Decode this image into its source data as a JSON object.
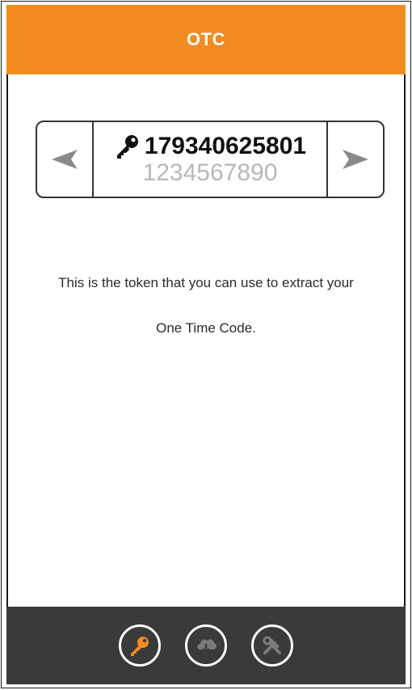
{
  "header": {
    "title": "OTC"
  },
  "token_selector": {
    "current_token": "179340625801",
    "next_token": "1234567890",
    "prev_icon": "left-arrow-icon",
    "next_icon": "right-arrow-icon",
    "token_icon": "key-icon"
  },
  "content": {
    "description_line1": "This is the token that you can use to extract your",
    "description_line2": "One Time Code."
  },
  "bottom_nav": {
    "items": [
      {
        "icon": "key-icon",
        "active": true
      },
      {
        "icon": "cloud-download-icon",
        "active": false
      },
      {
        "icon": "tools-icon",
        "active": false
      }
    ]
  },
  "colors": {
    "accent": "#f18b22",
    "bottom_bar": "#3a3a3a",
    "inactive_icon": "#7a7a7a"
  }
}
